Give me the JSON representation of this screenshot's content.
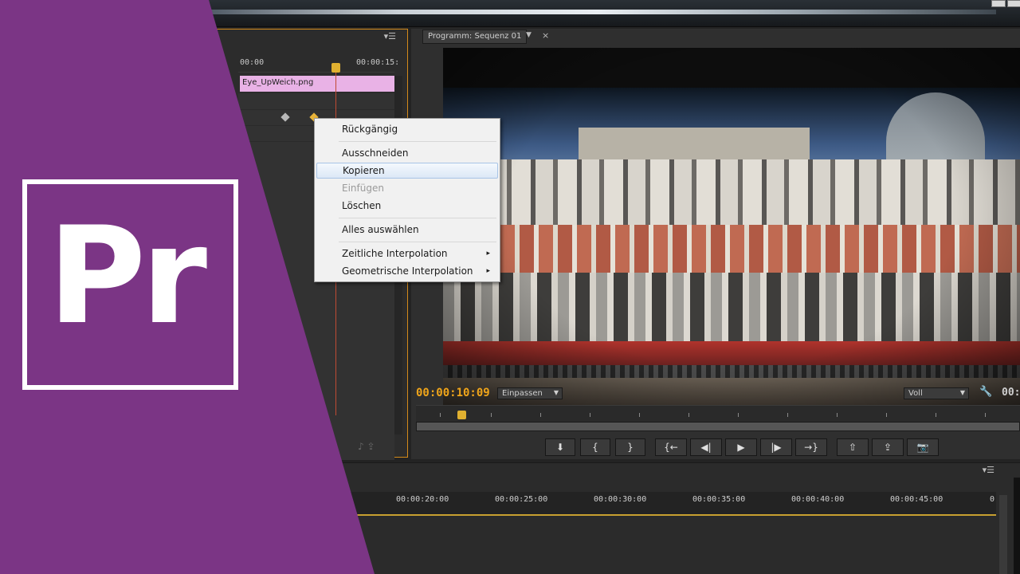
{
  "effect_controls": {
    "ruler_start": "00:00",
    "ruler_end": "00:00:15:",
    "clip_name": "Eye_UpWeich.png"
  },
  "program_monitor": {
    "tab_label": "Programm: Sequenz 01",
    "close_glyph": "×",
    "current_time": "00:00:10:09",
    "fit_select": "Einpassen",
    "quality_select": "Voll",
    "duration_time": "00:",
    "controls": [
      {
        "name": "add-marker-button",
        "glyph": "⬇"
      },
      {
        "name": "mark-in-button",
        "glyph": "{"
      },
      {
        "name": "mark-out-button",
        "glyph": "}"
      },
      {
        "name": "go-to-in-button",
        "glyph": "{←"
      },
      {
        "name": "step-back-button",
        "glyph": "◀|"
      },
      {
        "name": "play-button",
        "glyph": "▶"
      },
      {
        "name": "step-forward-button",
        "glyph": "|▶"
      },
      {
        "name": "go-to-out-button",
        "glyph": "→}"
      },
      {
        "name": "lift-button",
        "glyph": "⇧"
      },
      {
        "name": "extract-button",
        "glyph": "⇪"
      },
      {
        "name": "export-frame-button",
        "glyph": "📷"
      }
    ]
  },
  "timeline": {
    "ruler_labels": [
      "00:00:20:00",
      "00:00:25:00",
      "00:00:30:00",
      "00:00:35:00",
      "00:00:40:00",
      "00:00:45:00",
      "0"
    ]
  },
  "context_menu": {
    "items": [
      {
        "label": "Rückgängig",
        "state": "normal",
        "submenu": false
      },
      {
        "label": "Ausschneiden",
        "state": "normal",
        "submenu": false
      },
      {
        "label": "Kopieren",
        "state": "highlight",
        "submenu": false
      },
      {
        "label": "Einfügen",
        "state": "disabled",
        "submenu": false
      },
      {
        "label": "Löschen",
        "state": "normal",
        "submenu": false
      },
      {
        "label": "Alles auswählen",
        "state": "normal",
        "submenu": false
      },
      {
        "label": "Zeitliche Interpolation",
        "state": "normal",
        "submenu": true
      },
      {
        "label": "Geometrische Interpolation",
        "state": "normal",
        "submenu": true
      }
    ],
    "submenu_glyph": "▸"
  },
  "logo": {
    "text": "Pr"
  },
  "colors": {
    "brand_purple": "#7b3585",
    "timecode_orange": "#f0a51a",
    "clip_pink": "#e9b2e6",
    "panel_focus_border": "#d48a1a"
  }
}
